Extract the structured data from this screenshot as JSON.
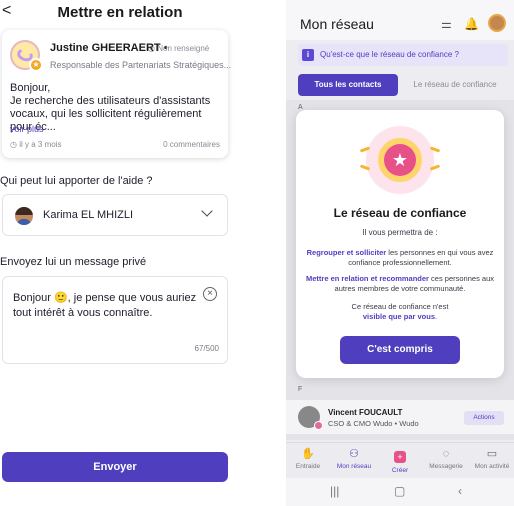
{
  "left": {
    "back_glyph": "<",
    "title": "Mettre en relation",
    "post": {
      "author": "Justine GHEERAERT",
      "dot": "•",
      "location": "Non renseigné",
      "role": "Responsable des Partenariats Stratégiques...",
      "body_line1": "Bonjour,",
      "body_line2": "Je recherche des utilisateurs d'assistants vocaux, qui les sollicitent régulièrement pour éc...",
      "more": "voir plus",
      "time": "il y a 3 mois",
      "comments": "0 commentaires"
    },
    "help_question": "Qui peut lui apporter de l'aide ?",
    "selected_person": "Karima EL MHIZLI",
    "message_label": "Envoyez lui un message privé",
    "message_text": "Bonjour 🙂, je pense que vous auriez tout intérêt à vous connaître.",
    "char_count": "67/500",
    "send_label": "Envoyer"
  },
  "right": {
    "title": "Mon réseau",
    "info_banner": "Qu'est-ce que le réseau de confiance ?",
    "tab_all": "Tous les contacts",
    "tab_trust": "Le réseau de confiance",
    "letter_a": "A",
    "letter_f": "F",
    "modal": {
      "title": "Le réseau de confiance",
      "subtitle": "Il vous permettra de :",
      "p1_hl": "Regrouper et solliciter",
      "p1_rest": " les personnes en qui vous avez confiance professionnellement.",
      "p2_hl": "Mettre en relation et recommander",
      "p2_rest": " ces personnes aux autres membres de votre communauté.",
      "p3_a": "Ce réseau de confiance n'est ",
      "p3_hl": "visible que par vous",
      "p3_b": ".",
      "ok_label": "C'est compris"
    },
    "contact": {
      "name": "Vincent FOUCAULT",
      "role": "CSO & CMO Wudo • Wudo",
      "action": "Actions"
    },
    "bottom_nav": [
      {
        "label": "Entraide",
        "icon": "hand-icon"
      },
      {
        "label": "Mon réseau",
        "icon": "people-icon"
      },
      {
        "label": "Créer",
        "icon": "plus-icon"
      },
      {
        "label": "Messagerie",
        "icon": "chat-icon"
      },
      {
        "label": "Mon activité",
        "icon": "chart-icon"
      }
    ],
    "accent_color": "#4f3fbf"
  }
}
